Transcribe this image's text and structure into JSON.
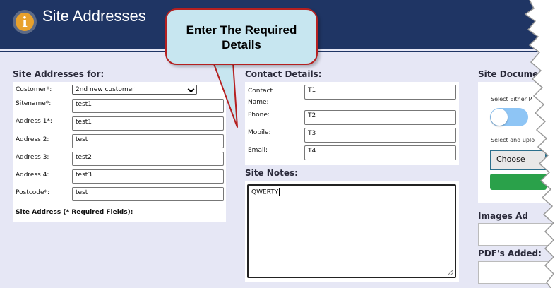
{
  "header": {
    "title": "Site Addresses"
  },
  "callout": {
    "text": "Enter The Required Details"
  },
  "site_addresses": {
    "heading": "Site Addresses for:",
    "customer_label": "Customer*:",
    "customer_value": "2nd new customer",
    "fields": [
      {
        "label": "Sitename*:",
        "value": "test1"
      },
      {
        "label": "Address 1*:",
        "value": "test1"
      },
      {
        "label": "Address 2:",
        "value": "test"
      },
      {
        "label": "Address 3:",
        "value": "test2"
      },
      {
        "label": "Address 4:",
        "value": "test3"
      },
      {
        "label": "Postcode*:",
        "value": "test"
      }
    ],
    "footer_note": "Site Address (* Required Fields):"
  },
  "contact": {
    "heading": "Contact Details:",
    "fields": [
      {
        "label": "Contact Name:",
        "value": "T1"
      },
      {
        "label": "Phone:",
        "value": "T2"
      },
      {
        "label": "Mobile:",
        "value": "T3"
      },
      {
        "label": "Email:",
        "value": "T4"
      }
    ]
  },
  "notes": {
    "heading": "Site Notes:",
    "value": "QWERTY"
  },
  "documents": {
    "heading": "Site Documer",
    "select_either": "Select Either P",
    "select_upload": "Select and uplo",
    "choose_label": "Choose",
    "images_heading": "Images Ad",
    "pdfs_heading": "PDF's Added:"
  },
  "colors": {
    "header": "#1f3564",
    "background": "#e6e7f5",
    "callout_fill": "#c7e6f0",
    "callout_border": "#b52020",
    "toggle": "#8ec5f5",
    "green_button": "#2aa14a"
  },
  "icons": {
    "info": "info-icon"
  }
}
